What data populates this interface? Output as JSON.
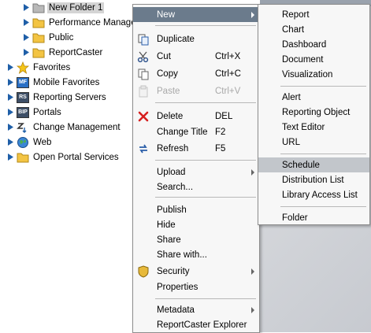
{
  "tree": {
    "items": [
      {
        "label": "New Folder 1",
        "icon": "folder-gray-icon",
        "selected": true
      },
      {
        "label": "Performance Managem",
        "icon": "folder-icon"
      },
      {
        "label": "Public",
        "icon": "folder-icon"
      },
      {
        "label": "ReportCaster",
        "icon": "folder-icon"
      },
      {
        "label": "Favorites",
        "icon": "star-icon"
      },
      {
        "label": "Mobile Favorites",
        "icon": "mobile-favorites-icon",
        "badge": "MF"
      },
      {
        "label": "Reporting Servers",
        "icon": "reporting-servers-icon",
        "badge": "RS"
      },
      {
        "label": "Portals",
        "icon": "portals-icon",
        "badge": "BIP"
      },
      {
        "label": "Change Management",
        "icon": "change-management-icon"
      },
      {
        "label": "Web",
        "icon": "globe-icon"
      },
      {
        "label": "Open Portal Services",
        "icon": "folder-icon"
      }
    ]
  },
  "context_menu": {
    "items": [
      {
        "label": "New",
        "submenu": true
      },
      {
        "label": "Duplicate",
        "icon": "duplicate-icon"
      },
      {
        "label": "Cut",
        "shortcut": "Ctrl+X",
        "icon": "scissors-icon"
      },
      {
        "label": "Copy",
        "shortcut": "Ctrl+C",
        "icon": "copy-icon"
      },
      {
        "label": "Paste",
        "shortcut": "Ctrl+V",
        "icon": "paste-icon",
        "disabled": true
      },
      {
        "label": "Delete",
        "shortcut": "DEL",
        "icon": "delete-x-icon"
      },
      {
        "label": "Change Title",
        "shortcut": "F2"
      },
      {
        "label": "Refresh",
        "shortcut": "F5",
        "icon": "refresh-icon"
      },
      {
        "label": "Upload",
        "submenu": true
      },
      {
        "label": "Search..."
      },
      {
        "label": "Publish"
      },
      {
        "label": "Hide"
      },
      {
        "label": "Share"
      },
      {
        "label": "Share with..."
      },
      {
        "label": "Security",
        "submenu": true,
        "icon": "shield-icon"
      },
      {
        "label": "Properties"
      },
      {
        "label": "Metadata",
        "submenu": true
      },
      {
        "label": "ReportCaster Explorer"
      }
    ]
  },
  "new_submenu": {
    "items": [
      {
        "label": "Report"
      },
      {
        "label": "Chart"
      },
      {
        "label": "Dashboard"
      },
      {
        "label": "Document"
      },
      {
        "label": "Visualization"
      },
      {
        "label": "Alert"
      },
      {
        "label": "Reporting Object"
      },
      {
        "label": "Text Editor"
      },
      {
        "label": "URL"
      },
      {
        "label": "Schedule",
        "highlighted": true
      },
      {
        "label": "Distribution List"
      },
      {
        "label": "Library Access List"
      },
      {
        "label": "Folder"
      }
    ]
  },
  "colors": {
    "folder": "#f3c443",
    "highlight": "#c2c6cb",
    "active_item": "#6b7b8c",
    "tree_arrow": "#1f5fa8"
  }
}
